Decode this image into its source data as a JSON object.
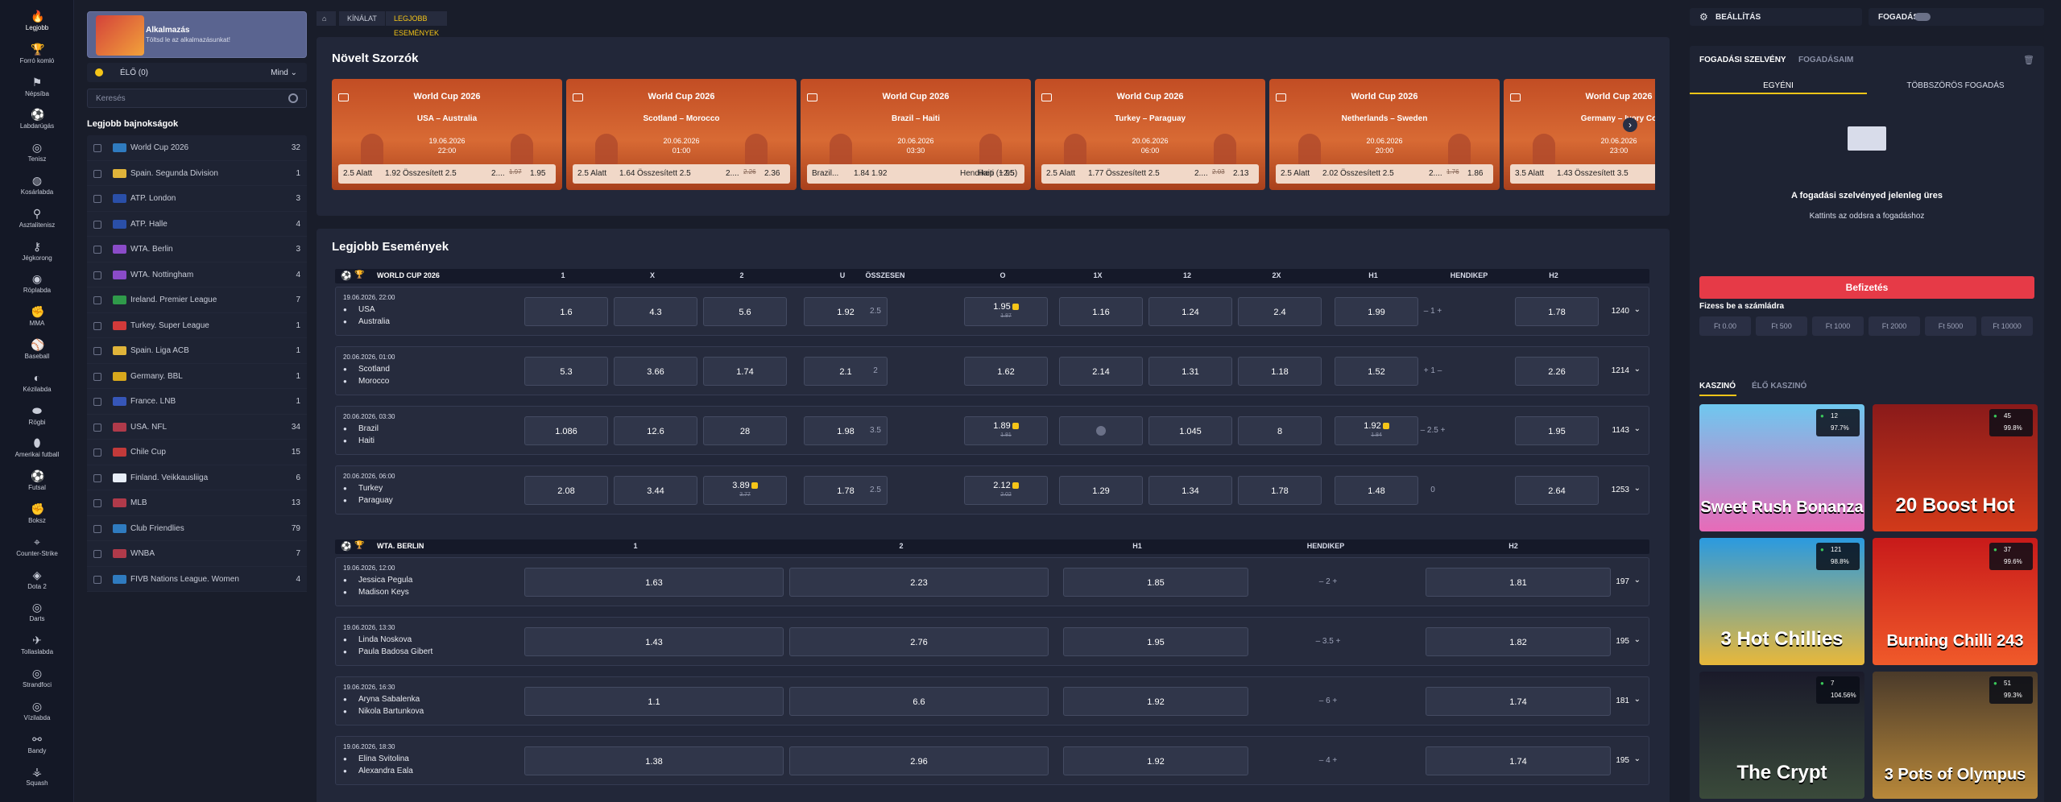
{
  "rail": [
    {
      "label": "Legjobb",
      "icon": "flame-icon"
    },
    {
      "label": "Forró komló",
      "icon": "trophy-icon"
    },
    {
      "label": "Népsíba",
      "icon": "people-icon"
    },
    {
      "label": "Labdarúgás",
      "icon": "soccer-ball-icon"
    },
    {
      "label": "Tenisz",
      "icon": "tennis-icon"
    },
    {
      "label": "Kosárlabda",
      "icon": "basketball-icon"
    },
    {
      "label": "Asztalitenisz",
      "icon": "table-tennis-icon"
    },
    {
      "label": "Jégkorong",
      "icon": "hockey-icon"
    },
    {
      "label": "Röplabda",
      "icon": "volleyball-icon"
    },
    {
      "label": "MMA",
      "icon": "mma-icon"
    },
    {
      "label": "Baseball",
      "icon": "baseball-icon"
    },
    {
      "label": "Kézilabda",
      "icon": "handball-icon"
    },
    {
      "label": "Rögbi",
      "icon": "rugby-icon"
    },
    {
      "label": "Amerikai futball",
      "icon": "american-football-icon"
    },
    {
      "label": "Futsal",
      "icon": "futsal-icon"
    },
    {
      "label": "Boksz",
      "icon": "boxing-icon"
    },
    {
      "label": "Counter-Strike",
      "icon": "counter-strike-icon"
    },
    {
      "label": "Dota 2",
      "icon": "dota-icon"
    },
    {
      "label": "Darts",
      "icon": "darts-icon"
    },
    {
      "label": "Tollaslabda",
      "icon": "badminton-icon"
    },
    {
      "label": "Strandfoci",
      "icon": "beach-soccer-icon"
    },
    {
      "label": "Vízilabda",
      "icon": "water-polo-icon"
    },
    {
      "label": "Bandy",
      "icon": "bandy-icon"
    },
    {
      "label": "Squash",
      "icon": "squash-icon"
    }
  ],
  "sidebar": {
    "app_title": "Alkalmazás",
    "app_sub": "Töltsd le az alkalmazásunkat!",
    "live_label": "ÉLŐ (0)",
    "live_filter": "Mind",
    "search_placeholder": "Keresés",
    "leagues_title": "Legjobb bajnokságok",
    "leagues": [
      {
        "name": "World Cup 2026",
        "count": "32",
        "color": "#2f7bbf"
      },
      {
        "name": "Spain. Segunda Division",
        "count": "1",
        "color": "#e0b43a"
      },
      {
        "name": "ATP. London",
        "count": "3",
        "color": "#2a4fa8"
      },
      {
        "name": "ATP. Halle",
        "count": "4",
        "color": "#2a4fa8"
      },
      {
        "name": "WTA. Berlin",
        "count": "3",
        "color": "#8a4bc8"
      },
      {
        "name": "WTA. Nottingham",
        "count": "4",
        "color": "#8a4bc8"
      },
      {
        "name": "Ireland. Premier League",
        "count": "7",
        "color": "#2f9a4a"
      },
      {
        "name": "Turkey. Super League",
        "count": "1",
        "color": "#d23a3a"
      },
      {
        "name": "Spain. Liga ACB",
        "count": "1",
        "color": "#e0b43a"
      },
      {
        "name": "Germany. BBL",
        "count": "1",
        "color": "#d8a81c"
      },
      {
        "name": "France. LNB",
        "count": "1",
        "color": "#3656b8"
      },
      {
        "name": "USA. NFL",
        "count": "34",
        "color": "#b03a4a"
      },
      {
        "name": "Chile Cup",
        "count": "15",
        "color": "#c23a3a"
      },
      {
        "name": "Finland. Veikkausliiga",
        "count": "6",
        "color": "#e8eef8"
      },
      {
        "name": "MLB",
        "count": "13",
        "color": "#b03a4a"
      },
      {
        "name": "Club Friendlies",
        "count": "79",
        "color": "#2f7bbf"
      },
      {
        "name": "WNBA",
        "count": "7",
        "color": "#b03a4a"
      },
      {
        "name": "FIVB Nations League. Women",
        "count": "4",
        "color": "#2f7bbf"
      }
    ]
  },
  "crumbs": {
    "home": "⌂",
    "offer": "KÍNÁLAT",
    "current": "LEGJOBB ESEMÉNYEK"
  },
  "boosted": {
    "title": "Növelt Szorzók",
    "cards": [
      {
        "comp": "World Cup 2026",
        "teams": "USA – Australia",
        "date": "19.06.2026",
        "time": "22:00",
        "o": [
          "2.5 Alatt",
          "1.92",
          "Összesített 2.5",
          "2....",
          "1.97",
          "1.95"
        ]
      },
      {
        "comp": "World Cup 2026",
        "teams": "Scotland – Morocco",
        "date": "20.06.2026",
        "time": "01:00",
        "o": [
          "2.5 Alatt",
          "1.64",
          "Összesített 2.5",
          "2....",
          "2.26",
          "2.36"
        ]
      },
      {
        "comp": "World Cup 2026",
        "teams": "Brazil – Haiti",
        "date": "20.06.2026",
        "time": "03:30",
        "o": [
          "Brazil...",
          "1.84",
          "1.92",
          "Hendikep",
          "Haiti (+2.5)",
          "1.95"
        ]
      },
      {
        "comp": "World Cup 2026",
        "teams": "Turkey – Paraguay",
        "date": "20.06.2026",
        "time": "06:00",
        "o": [
          "2.5 Alatt",
          "1.77",
          "Összesített 2.5",
          "2....",
          "2.03",
          "2.13"
        ]
      },
      {
        "comp": "World Cup 2026",
        "teams": "Netherlands – Sweden",
        "date": "20.06.2026",
        "time": "20:00",
        "o": [
          "2.5 Alatt",
          "2.02",
          "Összesített 2.5",
          "2....",
          "1.76",
          "1.86"
        ]
      },
      {
        "comp": "World Cup 2026",
        "teams": "Germany – Ivory Co",
        "date": "20.06.2026",
        "time": "23:00",
        "o": [
          "3.5 Alatt",
          "1.43",
          "Összesített 3.5",
          "",
          "",
          ""
        ]
      }
    ]
  },
  "events": {
    "title": "Legjobb Események",
    "wc_group": "WORLD CUP 2026",
    "wc_cols": [
      "1",
      "X",
      "2",
      "U",
      "ÖSSZESEN",
      "O",
      "1X",
      "12",
      "2X",
      "H1",
      "HENDIKEP",
      "H2"
    ],
    "wc_rows": [
      {
        "dt": "19.06.2026, 22:00",
        "t1": "USA",
        "t2": "Australia",
        "o1": "1.6",
        "ox": "4.3",
        "o2": "5.6",
        "u": "1.92",
        "tot": "2.5",
        "ov": "1.95",
        "ov_old": "1.87",
        "x1": "1.16",
        "x12": "1.24",
        "x2": "2.4",
        "h1": "1.99",
        "hc": "– 1 +",
        "h2": "1.78",
        "more": "1240"
      },
      {
        "dt": "20.06.2026, 01:00",
        "t1": "Scotland",
        "t2": "Morocco",
        "o1": "5.3",
        "ox": "3.66",
        "o2": "1.74",
        "u": "2.1",
        "tot": "2",
        "ov": "1.62",
        "ov_old": "",
        "x1": "2.14",
        "x12": "1.31",
        "x2": "1.18",
        "h1": "1.52",
        "hc": "+ 1 –",
        "h2": "2.26",
        "more": "1214"
      },
      {
        "dt": "20.06.2026, 03:30",
        "t1": "Brazil",
        "t2": "Haiti",
        "o1": "1.086",
        "ox": "12.6",
        "o2": "28",
        "u": "1.98",
        "tot": "3.5",
        "ov": "1.89",
        "ov_old": "1.81",
        "x1": "",
        "x12": "1.045",
        "x2": "8",
        "h1": "1.92",
        "h1_old": "1.84",
        "hc": "– 2.5 +",
        "h2": "1.95",
        "more": "1143"
      },
      {
        "dt": "20.06.2026, 06:00",
        "t1": "Turkey",
        "t2": "Paraguay",
        "o1": "2.08",
        "ox": "3.44",
        "o2": "3.89",
        "o2_old": "3.77",
        "u": "1.78",
        "tot": "2.5",
        "ov": "2.12",
        "ov_old": "2.02",
        "x1": "1.29",
        "x12": "1.34",
        "x2": "1.78",
        "h1": "1.48",
        "hc": "0",
        "h2": "2.64",
        "more": "1253"
      }
    ],
    "wta_group": "WTA. BERLIN",
    "wta_cols": [
      "1",
      "2",
      "H1",
      "HENDIKEP",
      "H2"
    ],
    "wta_rows": [
      {
        "dt": "19.06.2026, 12:00",
        "t1": "Jessica Pegula",
        "t2": "Madison Keys",
        "o1": "1.63",
        "o2": "2.23",
        "h1": "1.85",
        "hc": "– 2 +",
        "h2": "1.81",
        "more": "197"
      },
      {
        "dt": "19.06.2026, 13:30",
        "t1": "Linda Noskova",
        "t2": "Paula Badosa Gibert",
        "o1": "1.43",
        "o2": "2.76",
        "h1": "1.95",
        "hc": "– 3.5 +",
        "h2": "1.82",
        "more": "195"
      },
      {
        "dt": "19.06.2026, 16:30",
        "t1": "Aryna Sabalenka",
        "t2": "Nikola Bartunkova",
        "o1": "1.1",
        "o2": "6.6",
        "h1": "1.92",
        "hc": "– 6 +",
        "h2": "1.74",
        "more": "181"
      },
      {
        "dt": "19.06.2026, 18:30",
        "t1": "Elina Svitolina",
        "t2": "Alexandra Eala",
        "o1": "1.38",
        "o2": "2.96",
        "h1": "1.92",
        "hc": "– 4 +",
        "h2": "1.74",
        "more": "195"
      }
    ]
  },
  "right": {
    "settings": "BEÁLLÍTÁS",
    "betting": "FOGADÁS",
    "slip_tab": "FOGADÁSI SZELVÉNY",
    "bets_tab": "FOGADÁSAIM",
    "single": "EGYÉNI",
    "multi": "TÖBBSZÖRÖS FOGADÁS",
    "empty1": "A fogadási szelvényed jelenleg üres",
    "empty2": "Kattints az oddsra a fogadáshoz",
    "pay_btn": "Befizetés",
    "deposit_lbl": "Fizess be a számládra",
    "amounts": [
      "Ft  0.00",
      "Ft  500",
      "Ft  1000",
      "Ft  2000",
      "Ft  5000",
      "Ft  10000"
    ],
    "casino_tab": "KASZINÓ",
    "live_casino_tab": "ÉLŐ KASZINÓ",
    "games": [
      {
        "name": "Sweet Rush Bonanza",
        "players": "12",
        "rtp": "97.7%",
        "bg": "linear-gradient(180deg,#6ec8f0,#e86ab8)"
      },
      {
        "name": "20 Boost Hot",
        "players": "45",
        "rtp": "99.8%",
        "bg": "linear-gradient(180deg,#8a1a1a,#d23a1a)"
      },
      {
        "name": "3 Hot Chillies",
        "players": "121",
        "rtp": "98.8%",
        "bg": "linear-gradient(180deg,#2a9ae0,#e8b83a)"
      },
      {
        "name": "Burning Chilli 243",
        "players": "37",
        "rtp": "99.6%",
        "bg": "linear-gradient(180deg,#c81a1a,#f05a2a)"
      },
      {
        "name": "The Crypt",
        "players": "7",
        "rtp": "104.56%",
        "bg": "linear-gradient(180deg,#1a1a2a,#3a4a3a)"
      },
      {
        "name": "3 Pots of Olympus",
        "players": "51",
        "rtp": "99.3%",
        "bg": "linear-gradient(180deg,#4a3a2a,#b8883a)"
      }
    ]
  }
}
